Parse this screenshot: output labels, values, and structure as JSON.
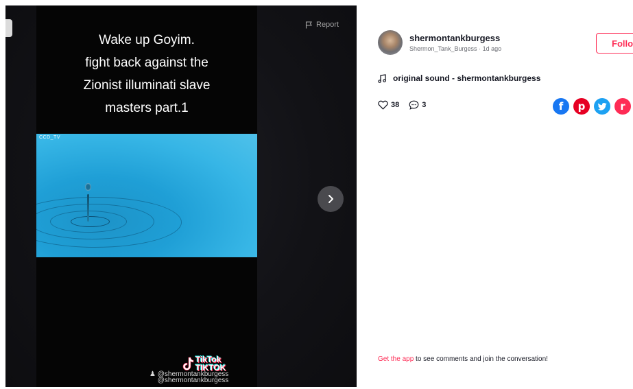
{
  "video": {
    "report_label": "Report",
    "caption_lines": [
      "Wake up Goyim.",
      "fight back against the",
      "Zionist illuminati slave",
      "masters part.1"
    ],
    "inner_watermark": "CCD_TV",
    "tiktok_brand_top": "TikTok",
    "tiktok_brand_bottom": "TIKTOK",
    "handle_line_1": "@shermontankburgess",
    "handle_line_2": "@shermontankburgess",
    "next_icon": "chevron-right-icon"
  },
  "author": {
    "username": "shermontankburgess",
    "display_name": "Shermon_Tank_Burgess",
    "separator": " · ",
    "posted": "1d ago",
    "follow_label": "Follow"
  },
  "sound": {
    "icon": "music-note-icon",
    "label": "original sound - shermontankburgess"
  },
  "stats": {
    "likes": "38",
    "comments": "3"
  },
  "share": {
    "icons": [
      "facebook-icon",
      "pinterest-icon",
      "twitter-icon",
      "reddit-icon"
    ],
    "colors": {
      "facebook": "#1877f2",
      "pinterest": "#e60023",
      "twitter": "#1da1f2",
      "reddit": "#fe2c55"
    }
  },
  "footer": {
    "get_app_link": "Get the app",
    "get_app_text": " to see comments and join the conversation!"
  },
  "colors": {
    "accent": "#fe2c55",
    "text": "#161823",
    "muted": "#6b6d73"
  }
}
